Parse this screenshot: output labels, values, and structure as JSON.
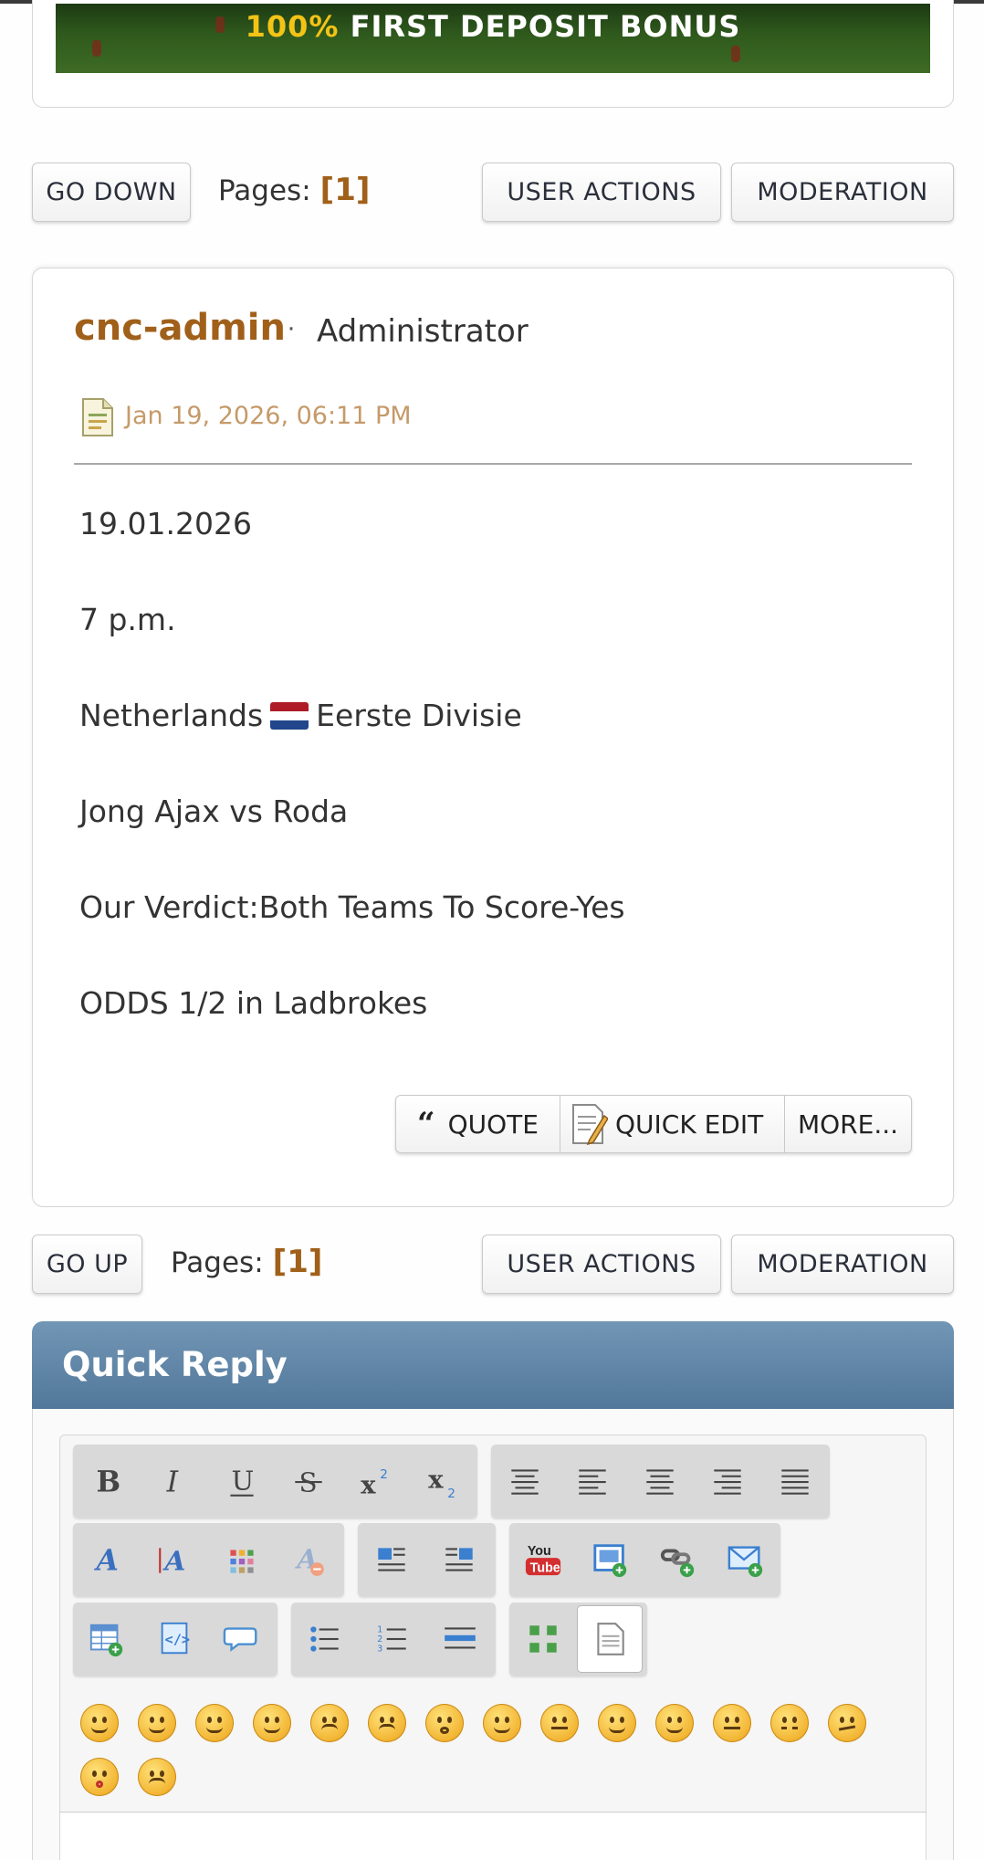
{
  "banner": {
    "percent": "100%",
    "text": "FIRST DEPOSIT BONUS"
  },
  "nav_top": {
    "go_label": "GO DOWN",
    "pages_label": "Pages:",
    "current_page": "[1]",
    "user_actions": "USER ACTIONS",
    "moderation": "MODERATION"
  },
  "post": {
    "author": "cnc-admin",
    "separator": "·",
    "role": "Administrator",
    "date": "Jan 19, 2026, 06:11 PM",
    "lines": [
      "19.01.2026",
      "7 p.m.",
      "Netherlands",
      "Eerste Divisie",
      "Jong Ajax vs Roda",
      "Our Verdict:Both Teams To Score-Yes",
      "ODDS 1/2 in Ladbrokes"
    ],
    "quote_label": "QUOTE",
    "quick_edit_label": "QUICK EDIT",
    "more_label": "MORE..."
  },
  "nav_bottom": {
    "go_label": "GO UP",
    "pages_label": "Pages:",
    "current_page": "[1]",
    "user_actions": "USER ACTIONS",
    "moderation": "MODERATION"
  },
  "quick_reply": {
    "title": "Quick Reply"
  },
  "toolbar_icons": [
    "bold-icon",
    "italic-icon",
    "underline-icon",
    "strikethrough-icon",
    "superscript-icon",
    "subscript-icon",
    "pre-icon",
    "align-left-icon",
    "align-center-icon",
    "align-right-icon",
    "justify-icon",
    "font-face-icon",
    "font-size-icon",
    "font-color-icon",
    "remove-format-icon",
    "float-left-icon",
    "float-right-icon",
    "youtube-icon",
    "insert-image-icon",
    "insert-link-icon",
    "insert-email-icon",
    "insert-table-icon",
    "insert-code-icon",
    "insert-quote-icon",
    "bulleted-list-icon",
    "ordered-list-icon",
    "horizontal-rule-icon",
    "maximize-icon",
    "source-icon"
  ],
  "emoticons": [
    "smiley",
    "wink",
    "cheesy",
    "grin",
    "angry",
    "sad",
    "shocked",
    "cool",
    "huh",
    "rolleyes",
    "tongue",
    "embarrassed",
    "lipsrsealed",
    "undecided",
    "kiss",
    "cry"
  ],
  "colors": {
    "accent": "#a0601a",
    "header": "#5a7fa2"
  }
}
